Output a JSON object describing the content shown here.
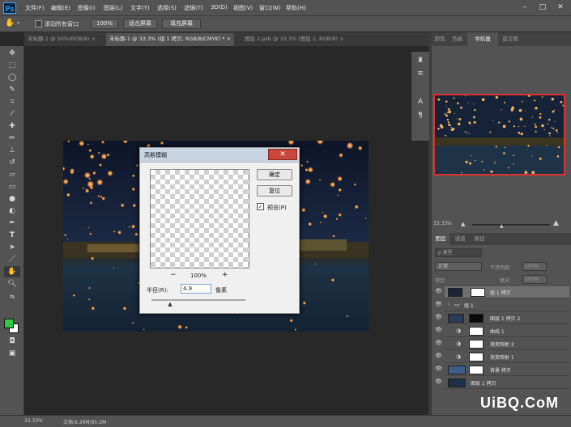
{
  "app": {
    "logo": "Ps"
  },
  "menu": [
    "文件(F)",
    "编辑(E)",
    "图像(I)",
    "图层(L)",
    "文字(Y)",
    "选择(S)",
    "滤镜(T)",
    "3D(D)",
    "视图(V)",
    "窗口(W)",
    "帮助(H)"
  ],
  "window_controls": {
    "minimize": "–",
    "maximize": "□",
    "close": "✕"
  },
  "options": {
    "scroll_all_label": "滚动所有窗口",
    "zoom_100": "100%",
    "fit_screen": "适合屏幕",
    "fill_screen": "填充屏幕"
  },
  "doc_tabs": [
    {
      "label": "未标题-1 @ 50%(RGB/8)"
    },
    {
      "label": "未标题-1 @ 33.3% (组 1 拷贝, RGB/8/CMYK) *"
    },
    {
      "label": "图层 2.psb @ 33.3% (图层 1, RGB/8)"
    }
  ],
  "gaussian": {
    "title": "高斯模糊",
    "close": "✕",
    "ok": "确定",
    "reset": "复位",
    "preview_label": "预览(P)",
    "zoom": "100%",
    "zoom_out": "−",
    "zoom_in": "+",
    "radius_label": "半径(R):",
    "radius_value": "4.9",
    "unit": "像素",
    "slider_level": 0.2
  },
  "right_panels": {
    "top_tabs": [
      "颜色",
      "色板",
      "导航器",
      "直方图"
    ],
    "active_top": "导航器",
    "nav_zoom": "33.33%",
    "layers_tabs": [
      "图层",
      "通道",
      "路径"
    ],
    "active_layers_tab": "图层",
    "filter_placeholder": "ρ 类型",
    "blend_mode": "正常",
    "opacity_label": "不透明度:",
    "opacity_value": "100%",
    "lock_label": "锁定:",
    "fill_label": "填充:",
    "fill_value": "100%",
    "layers": [
      {
        "name": "组 1 拷贝",
        "selected": true
      },
      {
        "name": "组 1",
        "folder": true
      },
      {
        "name": "图层 1 拷贝 2"
      },
      {
        "name": "曲线 1"
      },
      {
        "name": "渐变映射 2"
      },
      {
        "name": "渐变映射 1"
      },
      {
        "name": "背景 拷贝"
      },
      {
        "name": "图层 1 拷贝"
      }
    ]
  },
  "status": {
    "zoom": "33.33%",
    "doc_size": "文档:6.26M/95.2M"
  },
  "watermark": "UiBQ.CoM",
  "colors": {
    "foreground": "#2ecc40",
    "background": "#ffffff",
    "accent_nav": "#e03131"
  }
}
